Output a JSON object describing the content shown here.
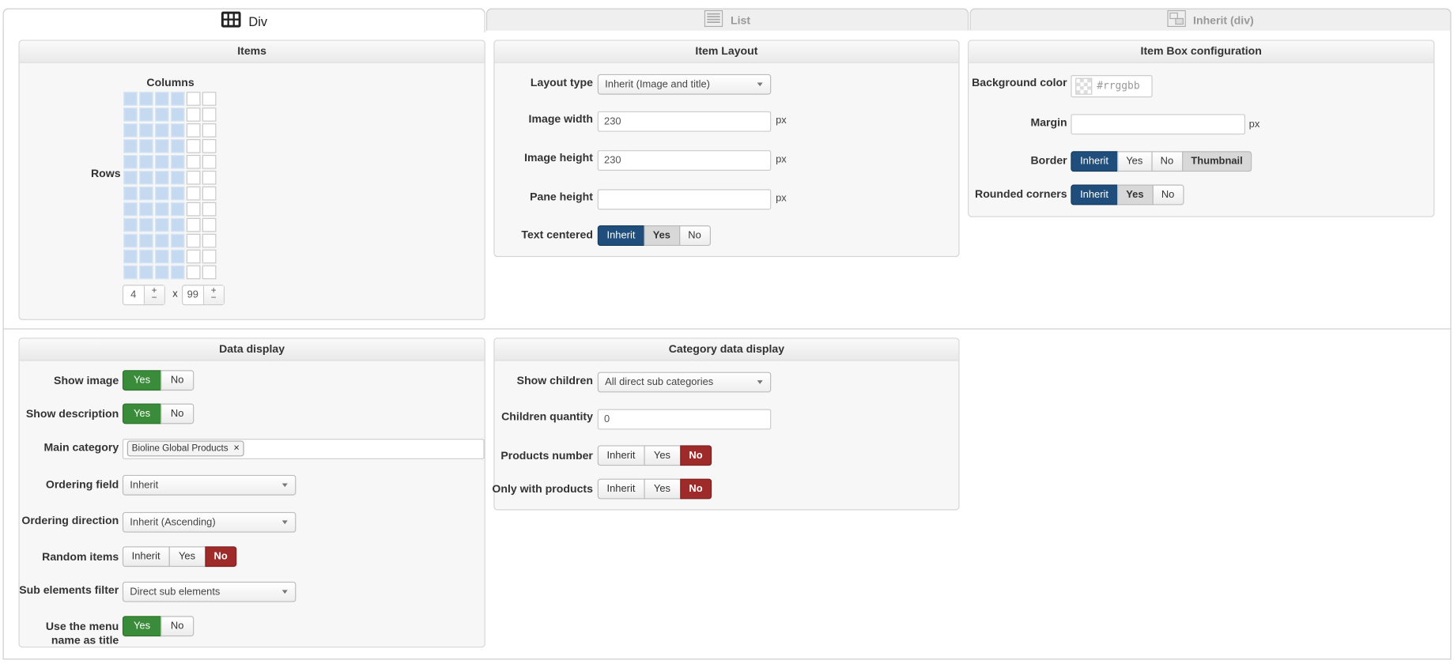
{
  "tabs": [
    {
      "label": "Div",
      "icon": "grid-icon",
      "active": true
    },
    {
      "label": "List",
      "icon": "list-icon",
      "active": false
    },
    {
      "label": "Inherit (div)",
      "icon": "inherit-layout-icon",
      "active": false
    }
  ],
  "items_panel": {
    "title": "Items",
    "columns_label": "Columns",
    "rows_label": "Rows",
    "columns_value": "4",
    "rows_value": "99",
    "times": "x",
    "plus": "+",
    "minus": "−"
  },
  "item_layout": {
    "title": "Item Layout",
    "layout_type_label": "Layout type",
    "layout_type_value": "Inherit (Image and title)",
    "image_width_label": "Image width",
    "image_width_value": "230",
    "image_height_label": "Image height",
    "image_height_value": "230",
    "pane_height_label": "Pane height",
    "pane_height_value": "",
    "unit": "px",
    "text_centered_label": "Text centered",
    "text_centered_options": [
      "Inherit",
      "Yes",
      "No"
    ]
  },
  "item_box": {
    "title": "Item Box configuration",
    "bg_color_label": "Background color",
    "bg_color_placeholder": "#rrggbb",
    "margin_label": "Margin",
    "margin_value": "",
    "unit": "px",
    "border_label": "Border",
    "border_options": [
      "Inherit",
      "Yes",
      "No",
      "Thumbnail"
    ],
    "rounded_label": "Rounded corners",
    "rounded_options": [
      "Inherit",
      "Yes",
      "No"
    ]
  },
  "data_display": {
    "title": "Data display",
    "show_image_label": "Show image",
    "show_image_options": [
      "Yes",
      "No"
    ],
    "show_description_label": "Show description",
    "show_description_options": [
      "Yes",
      "No"
    ],
    "main_category_label": "Main category",
    "main_category_tag": "Bioline Global Products",
    "tag_remove": "×",
    "ordering_field_label": "Ordering field",
    "ordering_field_value": "Inherit",
    "ordering_direction_label": "Ordering direction",
    "ordering_direction_value": "Inherit (Ascending)",
    "random_items_label": "Random items",
    "random_items_options": [
      "Inherit",
      "Yes",
      "No"
    ],
    "sub_filter_label": "Sub elements filter",
    "sub_filter_value": "Direct sub elements",
    "menu_title_label_1": "Use the menu",
    "menu_title_label_2": "name as title",
    "menu_title_options": [
      "Yes",
      "No"
    ]
  },
  "category_display": {
    "title": "Category data display",
    "show_children_label": "Show children",
    "show_children_value": "All direct sub categories",
    "children_qty_label": "Children quantity",
    "children_qty_value": "0",
    "products_number_label": "Products number",
    "products_number_options": [
      "Inherit",
      "Yes",
      "No"
    ],
    "only_products_label": "Only with products",
    "only_products_options": [
      "Inherit",
      "Yes",
      "No"
    ]
  },
  "colors": {
    "blue_active": "#1f4e7c",
    "green_active": "#3a8c3a",
    "red_active": "#9e2a2a",
    "grid_selected": "#c5daf0"
  }
}
